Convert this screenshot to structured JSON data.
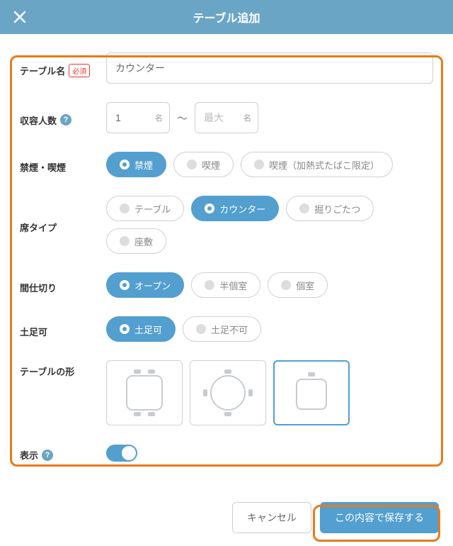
{
  "header": {
    "title": "テーブル追加"
  },
  "form": {
    "name": {
      "label": "テーブル名",
      "required": "必須",
      "value": "カウンター"
    },
    "capacity": {
      "label": "収容人数",
      "min": "1",
      "max_placeholder": "最大",
      "unit": "名",
      "sep": "〜"
    },
    "smoking": {
      "label": "禁煙・喫煙",
      "opts": [
        {
          "label": "禁煙",
          "sel": true
        },
        {
          "label": "喫煙",
          "sel": false
        },
        {
          "label": "喫煙（加熱式たばこ限定）",
          "sel": false
        }
      ]
    },
    "seat": {
      "label": "席タイプ",
      "opts": [
        {
          "label": "テーブル",
          "sel": false
        },
        {
          "label": "カウンター",
          "sel": true
        },
        {
          "label": "掘りごたつ",
          "sel": false
        },
        {
          "label": "座敷",
          "sel": false
        }
      ]
    },
    "partition": {
      "label": "間仕切り",
      "opts": [
        {
          "label": "オープン",
          "sel": true
        },
        {
          "label": "半個室",
          "sel": false
        },
        {
          "label": "個室",
          "sel": false
        }
      ]
    },
    "shoes": {
      "label": "土足可",
      "opts": [
        {
          "label": "土足可",
          "sel": true
        },
        {
          "label": "土足不可",
          "sel": false
        }
      ]
    },
    "shape": {
      "label": "テーブルの形",
      "selected": 2
    },
    "display": {
      "label": "表示",
      "on": true
    }
  },
  "footer": {
    "cancel": "キャンセル",
    "save": "この内容で保存する"
  }
}
